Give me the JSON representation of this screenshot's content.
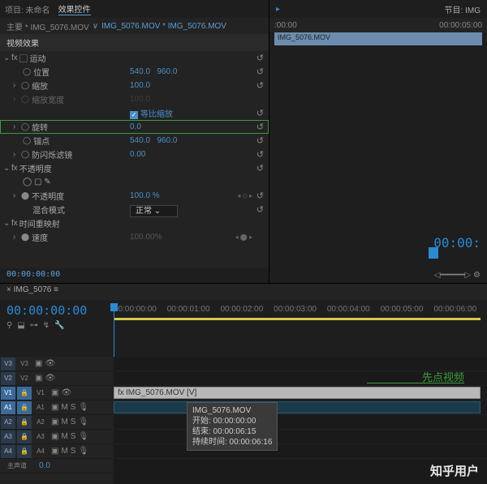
{
  "tabs": {
    "project": "项目: 未命名",
    "effects": "效果控件"
  },
  "breadcrumb": {
    "main": "主要 * IMG_5076.MOV",
    "sep": "∨",
    "clip": "IMG_5076.MOV * IMG_5076.MOV"
  },
  "section": "视频效果",
  "motion": {
    "label": "运动",
    "position": {
      "label": "位置",
      "x": "540.0",
      "y": "960.0"
    },
    "scale": {
      "label": "缩放",
      "val": "100.0"
    },
    "scale_w": {
      "label": "缩放宽度",
      "val": "100.0"
    },
    "uniform": {
      "label": "等比缩放"
    },
    "rotation": {
      "label": "旋转",
      "val": "0.0"
    },
    "anchor": {
      "label": "锚点",
      "x": "540.0",
      "y": "960.0"
    },
    "flicker": {
      "label": "防闪烁滤镜",
      "val": "0.00"
    }
  },
  "opacity": {
    "label": "不透明度",
    "value": {
      "label": "不透明度",
      "val": "100.0 %"
    },
    "blend": {
      "label": "混合模式",
      "val": "正常"
    }
  },
  "remap": {
    "label": "时间重映射",
    "speed": {
      "label": "速度",
      "val": "100.00%"
    }
  },
  "tc_small": "00:00:00:00",
  "right": {
    "program": "节目: IMG",
    "t0": ":00:00",
    "t1": "00:00:05:00",
    "clip": "IMG_5076.MOV",
    "big_tc": "00:00:"
  },
  "seq": {
    "tab": "IMG_5076",
    "timecode": "00:00:00:00",
    "ruler": [
      "00:00:00:00",
      "00:00:01:00",
      "00:00:02:00",
      "00:00:03:00",
      "00:00:04:00",
      "00:00:05:00",
      "00:00:06:00"
    ],
    "tracks": {
      "v3": "V3",
      "v2": "V2",
      "v1": "V1",
      "a1": "A1",
      "a2": "A2",
      "a3": "A3",
      "a4": "A4",
      "master": "主声道"
    },
    "clip_name": "IMG_5076.MOV [V]"
  },
  "tooltip": {
    "name": "IMG_5076.MOV",
    "start": "开始: 00:00:00:00",
    "end": "结束: 00:00:06:15",
    "dur": "持续时间: 00:00:06:16"
  },
  "annotation": "先点视频",
  "watermark": "知乎用户"
}
